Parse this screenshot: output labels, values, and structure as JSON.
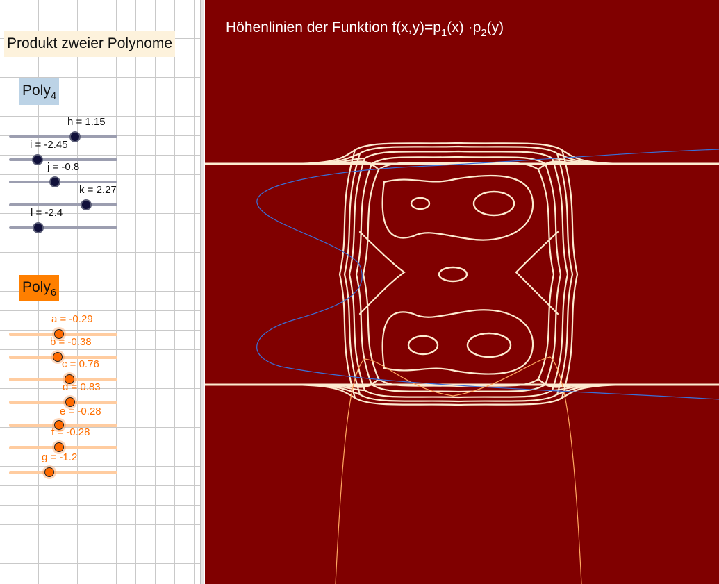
{
  "app": {
    "title": "Produkt zweier Polynome"
  },
  "poly4": {
    "label": "Poly",
    "subscript": "4",
    "color": "#bcd3e6",
    "sliders": [
      {
        "name": "h",
        "label": "h = 1.15",
        "value": 1.15
      },
      {
        "name": "i",
        "label": "i = -2.45",
        "value": -2.45
      },
      {
        "name": "j",
        "label": "j = -0.8",
        "value": -0.8
      },
      {
        "name": "k",
        "label": "k = 2.27",
        "value": 2.27
      },
      {
        "name": "l",
        "label": "l = -2.4",
        "value": -2.4
      }
    ]
  },
  "poly6": {
    "label": "Poly",
    "subscript": "6",
    "color": "#ff7f00",
    "sliders": [
      {
        "name": "a",
        "label": "a = -0.29",
        "value": -0.29
      },
      {
        "name": "b",
        "label": "b = -0.38",
        "value": -0.38
      },
      {
        "name": "c",
        "label": "c = 0.76",
        "value": 0.76
      },
      {
        "name": "d",
        "label": "d = 0.83",
        "value": 0.83
      },
      {
        "name": "e",
        "label": "e = -0.28",
        "value": -0.28
      },
      {
        "name": "f",
        "label": "f = -0.28",
        "value": -0.28
      },
      {
        "name": "g",
        "label": "g = -1.2",
        "value": -1.2
      }
    ]
  },
  "graph": {
    "title_prefix": "Höhenlinien der Funktion f(x,y)=p",
    "title_sub1": "1",
    "title_mid": "(x) ·p",
    "title_sub2": "2",
    "title_suffix": "(y)",
    "background_color": "#800000",
    "contour_color": "#fdebd0",
    "curve_blue_color": "#3a6fd8",
    "curve_orange_color": "#ffa860"
  }
}
